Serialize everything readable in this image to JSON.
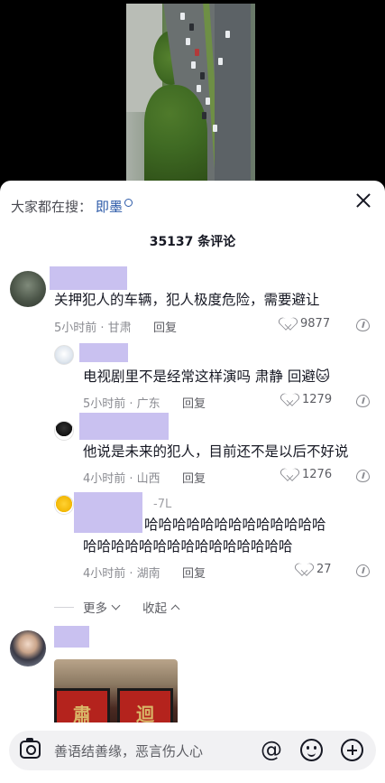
{
  "search": {
    "label": "大家都在搜：",
    "keyword": "即墨"
  },
  "comment_count": "35137 条评论",
  "comments": [
    {
      "text": "关押犯人的车辆，犯人极度危险，需要避让",
      "meta": "5小时前 · 甘肃",
      "reply": "回复",
      "likes": "9877"
    },
    {
      "text": "电视剧里不是经常这样演吗 肃静 回避",
      "emoji": "🐱",
      "meta": "5小时前 · 广东",
      "reply": "回复",
      "likes": "1279"
    },
    {
      "text": "他说是未来的犯人，目前还不是以后不好说",
      "meta": "4小时前 · 山西",
      "reply": "回复",
      "likes": "1276"
    },
    {
      "tag": "-7L",
      "text_line1": "哈哈哈哈哈哈哈哈哈哈哈哈哈",
      "text_line2": "哈哈哈哈哈哈哈哈哈哈哈哈哈哈哈",
      "meta": "4小时前 · 湖南",
      "reply": "回复",
      "likes": "27"
    }
  ],
  "more": {
    "expand": "更多",
    "collapse": "收起"
  },
  "photo_sign": {
    "left": "肅",
    "right": "迴"
  },
  "composer": {
    "placeholder": "善语结善缘，恶言伤人心",
    "at": "@"
  },
  "colors": {
    "accent_link": "#2c5aa8",
    "name_redaction": "#c9c1f0"
  }
}
